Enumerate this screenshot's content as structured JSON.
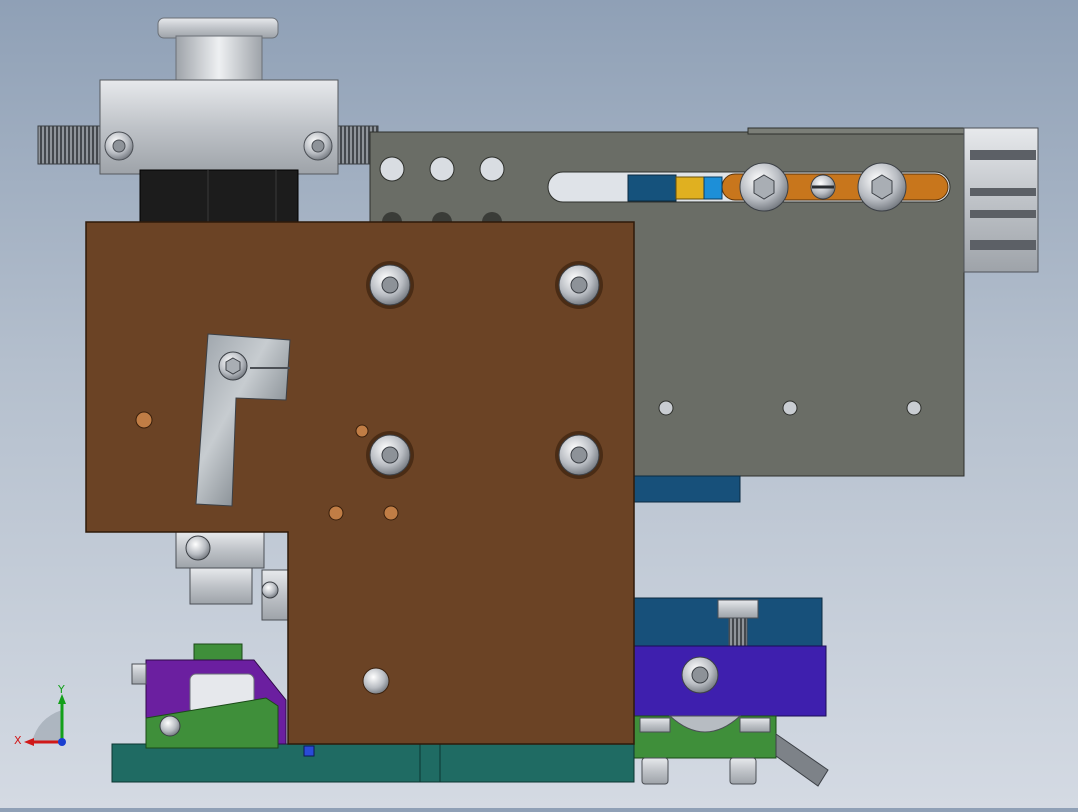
{
  "viewport": {
    "background_top": "#8fa0b6",
    "background_bottom": "#d4dae3"
  },
  "colors": {
    "brown_plate": "#6b4325",
    "gray_plate": "#6a6d66",
    "orange_slot": "#c8761c",
    "teal_base": "#1f6b63",
    "blue_block": "#17507a",
    "purple_block": "#6b1fa0",
    "indigo_block": "#3e1fae",
    "green_block": "#3f8f3a",
    "silver": "#c9ccd1",
    "black_block": "#1b1b1b"
  },
  "triad": {
    "x_label": "X",
    "y_label": "Y",
    "x_color": "#d01818",
    "y_color": "#13a01a",
    "z_color": "#1a3fd0"
  }
}
